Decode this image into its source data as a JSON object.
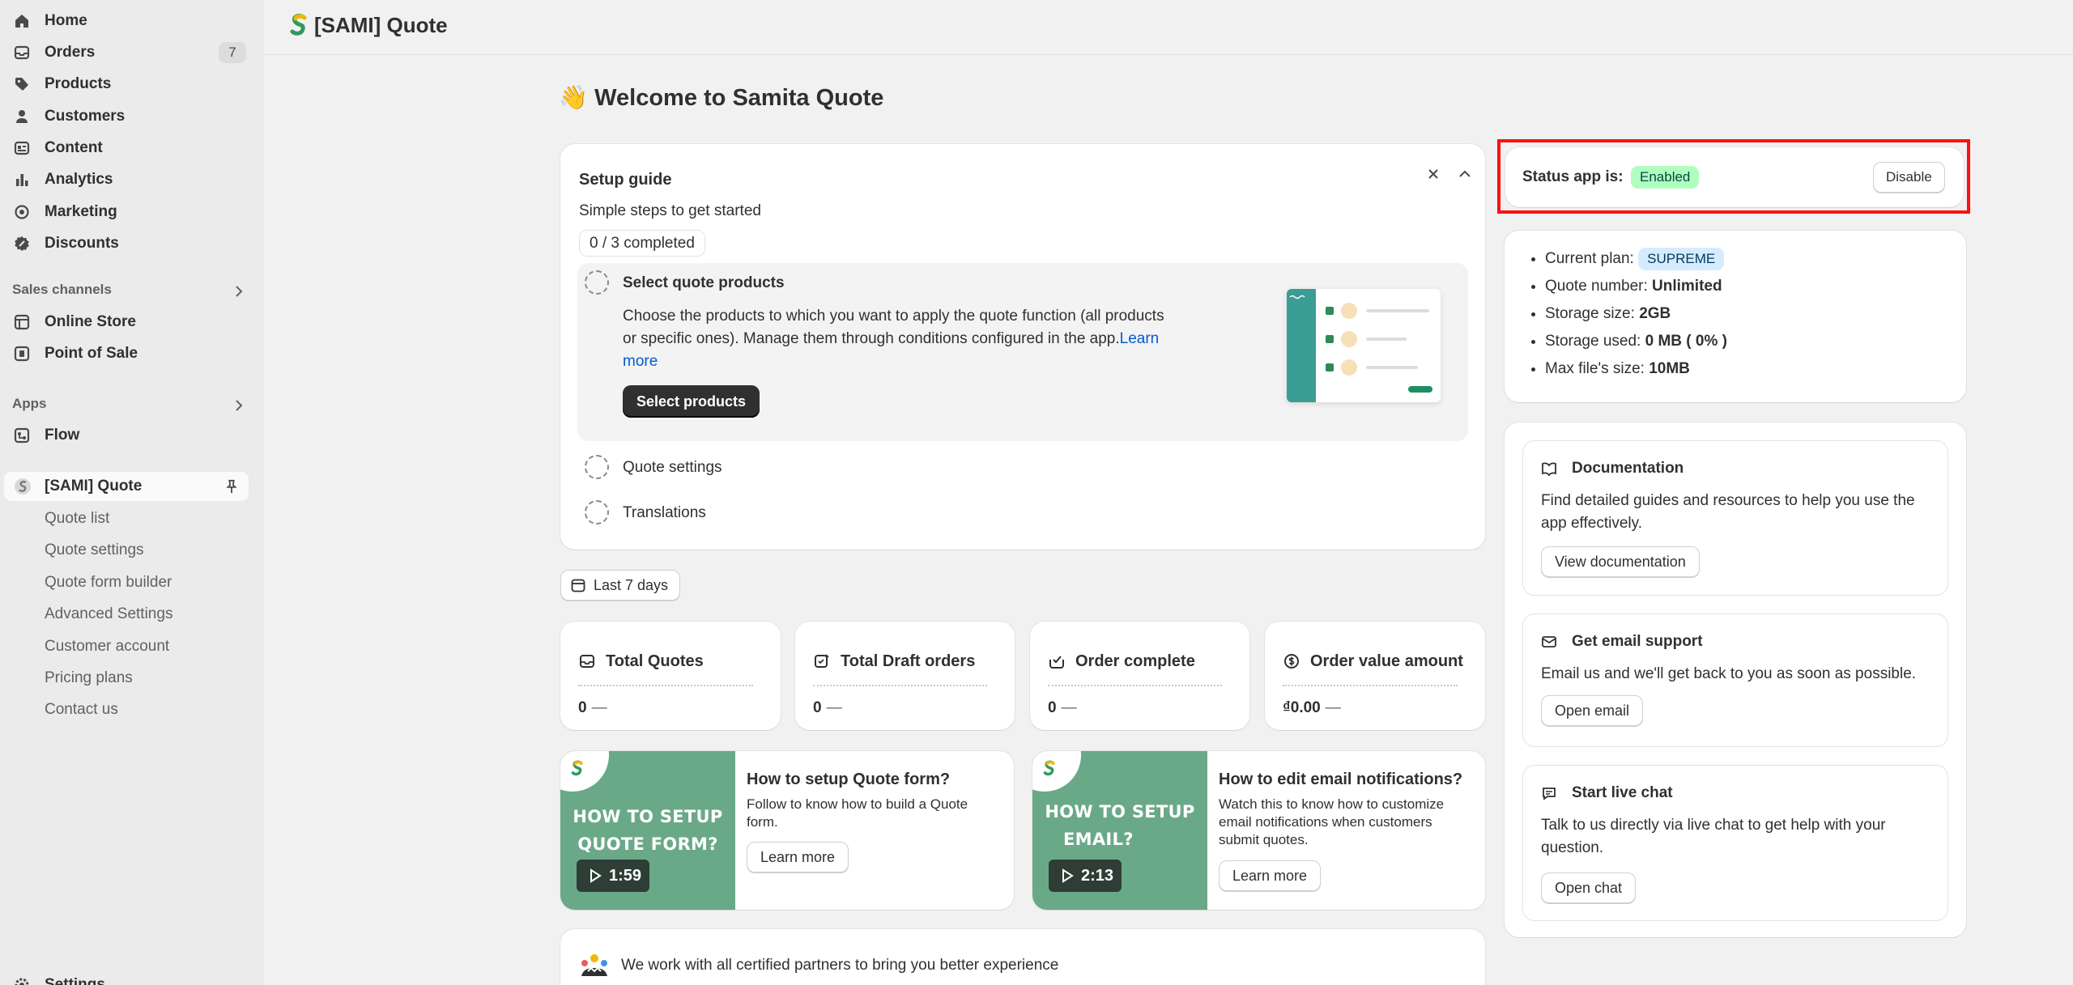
{
  "colors": {
    "accent_green": "#6aa988",
    "status_enabled": "#affebf",
    "plan_badge": "#d5ebff",
    "highlight_box": "#ff1010",
    "link": "#005bd3"
  },
  "sidebar": {
    "main_items": [
      {
        "label": "Home",
        "icon": "home-icon"
      },
      {
        "label": "Orders",
        "icon": "orders-icon",
        "badge": "7"
      },
      {
        "label": "Products",
        "icon": "tag-icon"
      },
      {
        "label": "Customers",
        "icon": "person-icon"
      },
      {
        "label": "Content",
        "icon": "content-icon"
      },
      {
        "label": "Analytics",
        "icon": "bar-chart-icon"
      },
      {
        "label": "Marketing",
        "icon": "target-icon"
      },
      {
        "label": "Discounts",
        "icon": "discount-icon"
      }
    ],
    "sales_channels_title": "Sales channels",
    "sales_channels": [
      {
        "label": "Online Store",
        "icon": "store-icon"
      },
      {
        "label": "Point of Sale",
        "icon": "pos-icon"
      }
    ],
    "apps_title": "Apps",
    "apps": [
      {
        "label": "Flow",
        "icon": "flow-icon"
      }
    ],
    "active_app": {
      "label": "[SAMI] Quote",
      "icon": "samita-logo-icon",
      "pin_icon": "pin-icon"
    },
    "sub_items": [
      "Quote list",
      "Quote settings",
      "Quote form builder",
      "Advanced Settings",
      "Customer account",
      "Pricing plans",
      "Contact us"
    ],
    "settings_label": "Settings"
  },
  "topbar": {
    "title": "[SAMI] Quote"
  },
  "welcome": {
    "title": "👋 Welcome to Samita Quote"
  },
  "setup_guide": {
    "title": "Setup guide",
    "subtitle": "Simple steps to get started",
    "progress": "0 / 3 completed",
    "progress_value": 0,
    "steps": [
      {
        "title": "Select quote products",
        "desc": "Choose the products to which you want to apply the quote function (all products or specific ones). Manage them through conditions configured in the app.",
        "link": "Learn more",
        "button": "Select products"
      },
      {
        "title": "Quote settings"
      },
      {
        "title": "Translations"
      }
    ]
  },
  "date_filter": {
    "label": "Last 7 days"
  },
  "metrics": [
    {
      "label": "Total Quotes",
      "value": "0",
      "icon": "inbox-icon"
    },
    {
      "label": "Total Draft orders",
      "value": "0",
      "icon": "draft-order-icon"
    },
    {
      "label": "Order complete",
      "value": "0",
      "icon": "order-complete-icon"
    },
    {
      "label": "Order value amount",
      "value": "₫0.00",
      "icon": "currency-icon"
    }
  ],
  "metric_dash": "—",
  "videos": [
    {
      "thumb_line1": "HOW TO SETUP",
      "thumb_line2": "QUOTE FORM?",
      "duration": "1:59",
      "title": "How to setup Quote form?",
      "desc": "Follow to know how to build a Quote form.",
      "button": "Learn more"
    },
    {
      "thumb_line1": "HOW TO SETUP",
      "thumb_line2": "EMAIL?",
      "duration": "2:13",
      "title": "How to edit email notifications?",
      "desc": "Watch this to know how to customize email notifications when customers submit quotes.",
      "button": "Learn more"
    }
  ],
  "partners": {
    "text": "We work with all certified partners to bring you better experience"
  },
  "status": {
    "label": "Status app is:",
    "value": "Enabled",
    "button": "Disable"
  },
  "plan": {
    "current_plan_label": "Current plan:",
    "current_plan": "SUPREME",
    "quote_number_label": "Quote number:",
    "quote_number": "Unlimited",
    "storage_size_label": "Storage size:",
    "storage_size": "2GB",
    "storage_used_label": "Storage used:",
    "storage_used": "0 MB ( 0% )",
    "max_file_label": "Max file's size:",
    "max_file": "10MB"
  },
  "support": [
    {
      "title": "Documentation",
      "desc": "Find detailed guides and resources to help you use the app effectively.",
      "button": "View documentation",
      "icon": "book-icon"
    },
    {
      "title": "Get email support",
      "desc": "Email us and we'll get back to you as soon as possible.",
      "button": "Open email",
      "icon": "email-icon"
    },
    {
      "title": "Start live chat",
      "desc": "Talk to us directly via live chat to get help with your question.",
      "button": "Open chat",
      "icon": "chat-icon"
    }
  ]
}
